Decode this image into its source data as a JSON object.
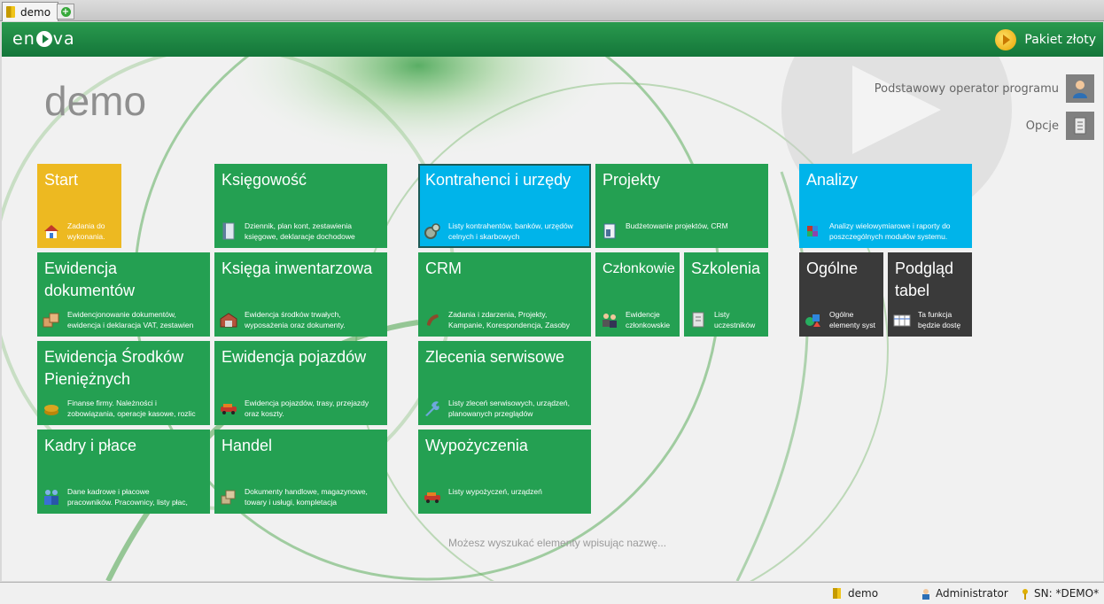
{
  "tab": {
    "label": "demo"
  },
  "header": {
    "logo": "enova",
    "package": "Pakiet złoty"
  },
  "page": {
    "title": "demo"
  },
  "user": {
    "operator": "Podstawowy operator programu",
    "options": "Opcje"
  },
  "tiles": [
    {
      "id": "start",
      "name": "Start",
      "desc": [
        "Zadania do",
        "wykonania."
      ],
      "icon": "house-icon"
    },
    {
      "id": "ksiegowosc",
      "name": "Księgowość",
      "desc": [
        "Dziennik, plan kont, zestawienia",
        "księgowe, deklaracje dochodowe"
      ],
      "icon": "book-icon"
    },
    {
      "id": "kontrahenci",
      "name": "Kontrahenci i urzędy",
      "desc": [
        "Listy kontrahentów, banków, urzędów",
        "celnych i skarbowych"
      ],
      "icon": "gears-icon"
    },
    {
      "id": "projekty",
      "name": "Projekty",
      "desc": [
        "Budżetowanie projektów, CRM"
      ],
      "icon": "document-icon"
    },
    {
      "id": "analizy",
      "name": "Analizy",
      "desc": [
        "Analizy wielowymiarowe i raporty do",
        "poszczególnych modułów systemu."
      ],
      "icon": "cube-icon"
    },
    {
      "id": "ewidencja-dok",
      "name": [
        "Ewidencja",
        "dokumentów"
      ],
      "desc": [
        "Ewidencjonowanie dokumentów,",
        "ewidencja i deklaracja VAT, zestawien"
      ],
      "icon": "boxes-icon"
    },
    {
      "id": "ksiega-inw",
      "name": "Księga inwentarzowa",
      "desc": [
        "Ewidencja środków trwałych,",
        "wyposażenia oraz dokumenty."
      ],
      "icon": "warehouse-icon"
    },
    {
      "id": "crm",
      "name": "CRM",
      "desc": [
        "Zadania i zdarzenia, Projekty,",
        "Kampanie, Korespondencja, Zasoby"
      ],
      "icon": "phone-icon"
    },
    {
      "id": "czlonkowie",
      "name": "Członkowie",
      "desc": [
        "Ewidencje",
        "członkowskie"
      ],
      "icon": "people-icon"
    },
    {
      "id": "szkolenia",
      "name": "Szkolenia",
      "desc": [
        "Listy",
        "uczestników"
      ],
      "icon": "list-icon"
    },
    {
      "id": "ogolne",
      "name": "Ogólne",
      "desc": [
        "Ogólne",
        "elementy syst"
      ],
      "icon": "shapes-icon"
    },
    {
      "id": "podglad",
      "name": [
        "Podgląd",
        "tabel"
      ],
      "desc": [
        "Ta funkcja",
        "będzie dostę"
      ],
      "icon": "table-icon"
    },
    {
      "id": "srodki-pien",
      "name": [
        "Ewidencja Środków",
        "Pieniężnych"
      ],
      "desc": [
        "Finanse firmy. Należności i",
        "zobowiązania, operacje kasowe, rozlic"
      ],
      "icon": "coins-icon"
    },
    {
      "id": "pojazdy",
      "name": "Ewidencja pojazdów",
      "desc": [
        "Ewidencja pojazdów, trasy, przejazdy",
        "oraz koszty."
      ],
      "icon": "car-icon"
    },
    {
      "id": "zlecenia",
      "name": "Zlecenia serwisowe",
      "desc": [
        "Listy zleceń serwisowych, urządzeń,",
        "planowanych przeglądów"
      ],
      "icon": "wrench-icon"
    },
    {
      "id": "kadry",
      "name": "Kadry i płace",
      "desc": [
        "Dane kadrowe i płacowe",
        "pracowników. Pracownicy, listy płac,"
      ],
      "icon": "workers-icon"
    },
    {
      "id": "handel",
      "name": "Handel",
      "desc": [
        "Dokumenty handlowe, magazynowe,",
        "towary i usługi, kompletacja"
      ],
      "icon": "packages-icon"
    },
    {
      "id": "wypozyczenia",
      "name": "Wypożyczenia",
      "desc": [
        "Listy wypożyczeń, urządzeń"
      ],
      "icon": "car-icon"
    }
  ],
  "hint": "Możesz wyszukać elementy wpisując nazwę...",
  "status": {
    "db": "demo",
    "user": "Administrator",
    "sn": "SN: *DEMO*"
  },
  "colors": {
    "green": "#24a052",
    "yellow": "#edb921",
    "blue": "#00b4ea",
    "dark": "#3a3a3a",
    "header": "#14763a"
  }
}
